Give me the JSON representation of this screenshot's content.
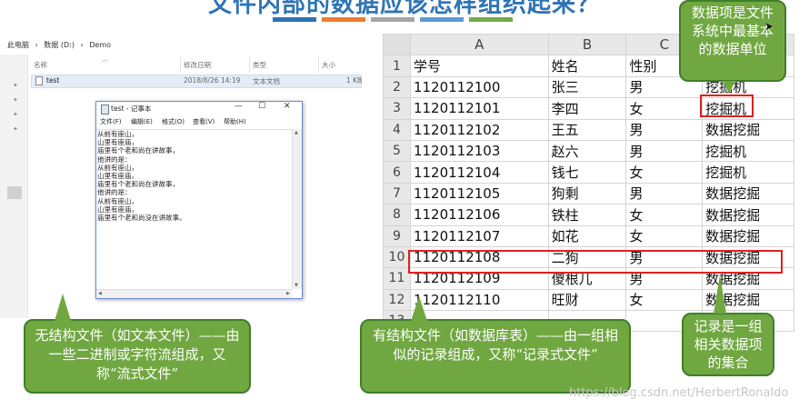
{
  "slide": {
    "title": "文件内部的数据应该怎样组织起来？",
    "bar_colors": [
      "#2e74b5",
      "#ed7d31",
      "#a5a5a5",
      "#5b9bd5",
      "#70ad47"
    ]
  },
  "explorer": {
    "breadcrumb": [
      "此电脑",
      "›",
      "数据 (D:)",
      "›",
      "Demo"
    ],
    "columns": [
      "名称",
      "修改日期",
      "类型",
      "大小"
    ],
    "file": {
      "name": "test",
      "modified": "2018/8/26 14:19",
      "type": "文本文档",
      "size": "1 KB"
    }
  },
  "notepad": {
    "title": "test - 记事本",
    "menu": [
      "文件(F)",
      "编辑(E)",
      "格式(O)",
      "查看(V)",
      "帮助(H)"
    ],
    "lines": [
      "从前有座山，",
      "山里有座庙，",
      "庙里有个老和尚在讲故事，",
      "他讲的是：",
      "从前有座山，",
      "山里有座庙，",
      "庙里有个老和尚在讲故事，",
      "他讲的是：",
      "从前有座山，",
      "山里有座庙，",
      "庙里有个老和尚没在讲故事。"
    ]
  },
  "sheet": {
    "columns": [
      "A",
      "B",
      "C"
    ],
    "row_numbers": [
      "1",
      "2",
      "3",
      "4",
      "5",
      "6",
      "7",
      "8",
      "9",
      "10",
      "11",
      "12",
      "13"
    ],
    "rows": [
      [
        "学号",
        "姓名",
        "性别",
        ""
      ],
      [
        "1120112100",
        "张三",
        "男",
        "挖掘机"
      ],
      [
        "1120112101",
        "李四",
        "女",
        "挖掘机"
      ],
      [
        "1120112102",
        "王五",
        "男",
        "数据挖掘"
      ],
      [
        "1120112103",
        "赵六",
        "男",
        "挖掘机"
      ],
      [
        "1120112104",
        "钱七",
        "女",
        "挖掘机"
      ],
      [
        "1120112105",
        "狗剩",
        "男",
        "数据挖掘"
      ],
      [
        "1120112106",
        "铁柱",
        "女",
        "数据挖掘"
      ],
      [
        "1120112107",
        "如花",
        "女",
        "数据挖掘"
      ],
      [
        "1120112108",
        "二狗",
        "男",
        "数据挖掘"
      ],
      [
        "1120112109",
        "傻根儿",
        "男",
        "数据挖掘"
      ],
      [
        "1120112110",
        "旺财",
        "女",
        "数据挖掘"
      ],
      [
        "",
        "",
        "",
        ""
      ]
    ]
  },
  "callouts": {
    "data_item": "数据项是文件系统中最基本的数据单位",
    "record": "记录是一组相关数据项的集合",
    "unstructured": "无结构文件（如文本文件）——由一些二进制或字符流组成，又称“流式文件”",
    "structured": "有结构文件（如数据库表）——由一组相似的记录组成，又称“记录式文件”"
  },
  "watermark": "https://blog.csdn.net/HerbertRonaldo",
  "colors": {
    "callout_green": "#70a741",
    "callout_border": "#3f7e2a",
    "highlight_red": "#e02020",
    "title_blue": "#2e74b5"
  }
}
